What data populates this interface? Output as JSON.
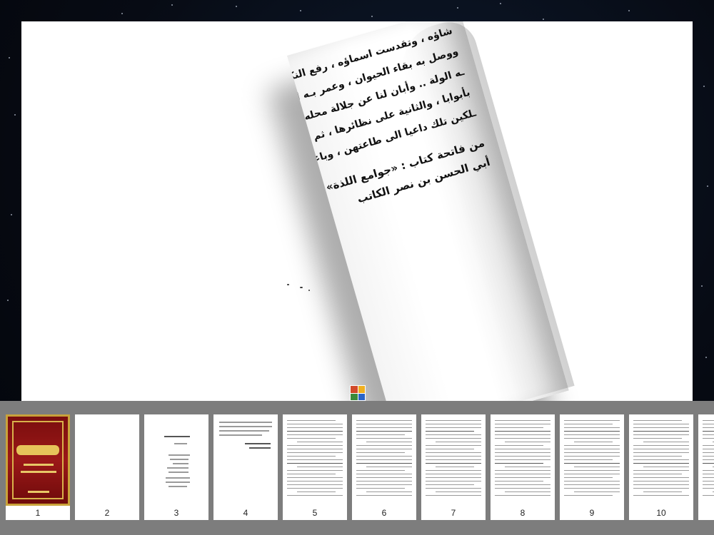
{
  "reader": {
    "curled_page_lines": [
      "شاؤه ، وتقدست اسماؤه ، رفع النكاح ، وأعلى",
      "ووصل به بقاء الحيوان ، وعمر بـه البلاد ،",
      "ـه الولة .. وأبان لنا عن جلالة محله ، بما",
      "بأبوابا ، والثانية على نظائرها ، ثم باشعاعها",
      "ـلكين تلك داعيا الى طاعتهن ، وباعثا على"
    ],
    "curled_page_heading": [
      "من فاتحة كتاب : «جوامع اللذة»",
      "أبي الحسن بن نصر الكاتب"
    ]
  },
  "thumbnails": [
    {
      "label": "1",
      "kind": "cover"
    },
    {
      "label": "2",
      "kind": "blank"
    },
    {
      "label": "3",
      "kind": "sparse"
    },
    {
      "label": "4",
      "kind": "short"
    },
    {
      "label": "5",
      "kind": "text"
    },
    {
      "label": "6",
      "kind": "text"
    },
    {
      "label": "7",
      "kind": "text"
    },
    {
      "label": "8",
      "kind": "text"
    },
    {
      "label": "9",
      "kind": "text"
    },
    {
      "label": "10",
      "kind": "text"
    },
    {
      "label": "",
      "kind": "text"
    }
  ],
  "colors": {
    "strip_background": "#7d7d7d",
    "cover_red": "#9b1818",
    "cover_gold": "#c9a23a"
  },
  "icons": {
    "app_icon": "app-logo-icon"
  }
}
